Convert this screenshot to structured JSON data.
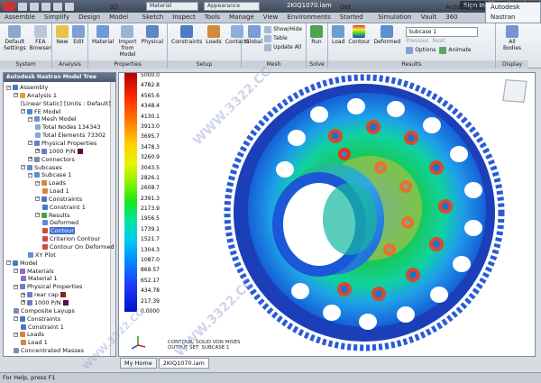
{
  "window": {
    "doc_title": "2KIQ1070.iam",
    "signin": "Sign In",
    "material_dropdown": "Material",
    "appearance_dropdown": "Appearance"
  },
  "tabs": [
    "Assemble",
    "Simplify",
    "Design",
    "3D Model",
    "Sketch",
    "Inspect",
    "Tools",
    "Manage",
    "View",
    "Environments",
    "Get Started",
    "Simulation",
    "Vault",
    "Autodesk 360",
    "Autodesk Nastran"
  ],
  "active_tab": "Autodesk Nastran",
  "ribbon": {
    "system": {
      "label": "System",
      "default_settings": "Default Settings",
      "fea_browser": "FEA Browser"
    },
    "analysis": {
      "label": "Analysis",
      "new": "New",
      "edit": "Edit"
    },
    "properties": {
      "label": "Properties",
      "material": "Material",
      "import_from_model": "Import from Model",
      "physical": "Physical"
    },
    "setup": {
      "label": "Setup",
      "constraints": "Constraints",
      "loads": "Loads",
      "contacts": "Contacts"
    },
    "mesh": {
      "label": "Mesh",
      "global": "Global",
      "show_hide": "Show/Hide",
      "table": "Table",
      "update_all": "Update All"
    },
    "solve": {
      "label": "Solve",
      "run": "Run"
    },
    "results": {
      "label": "Results",
      "load": "Load",
      "contour": "Contour",
      "deformed": "Deformed",
      "subcase_select": "Subcase 1",
      "previous": "Previous",
      "next": "Next",
      "options": "Options",
      "animate": "Animate"
    },
    "display": {
      "label": "Display",
      "all_bodies": "All Bodies"
    }
  },
  "panel": {
    "title": "Autodesk Nastran Model Tree"
  },
  "tree": [
    {
      "label": "Assembly",
      "level": 0,
      "exp": "-",
      "icon": "assembly-icon"
    },
    {
      "label": "Analysis 1",
      "level": 1,
      "exp": "-",
      "icon": "analysis-icon"
    },
    {
      "label": "[Linear Static] [Units : Default]",
      "level": 2,
      "exp": "",
      "icon": ""
    },
    {
      "label": "FE Model",
      "level": 2,
      "exp": "-",
      "icon": "fe-model-icon"
    },
    {
      "label": "Mesh Model",
      "level": 3,
      "exp": "-",
      "icon": "mesh-icon"
    },
    {
      "label": "Total Nodes 134343",
      "level": 4,
      "exp": "",
      "icon": "info-icon"
    },
    {
      "label": "Total Elements 73302",
      "level": 4,
      "exp": "",
      "icon": "info-icon"
    },
    {
      "label": "Physical Properties",
      "level": 3,
      "exp": "-",
      "icon": "property-icon"
    },
    {
      "label": "1000 P/N",
      "level": 4,
      "exp": "+",
      "icon": "property-icon",
      "swatch": "#55114a"
    },
    {
      "label": "Connectors",
      "level": 3,
      "exp": "+",
      "icon": "connector-icon"
    },
    {
      "label": "Subcases",
      "level": 2,
      "exp": "-",
      "icon": "subcase-icon"
    },
    {
      "label": "Subcase 1",
      "level": 3,
      "exp": "-",
      "icon": "subcase-icon"
    },
    {
      "label": "Loads",
      "level": 4,
      "exp": "-",
      "icon": "load-icon"
    },
    {
      "label": "Load 1",
      "level": 5,
      "exp": "",
      "icon": "load-icon"
    },
    {
      "label": "Constraints",
      "level": 4,
      "exp": "-",
      "icon": "constraint-icon"
    },
    {
      "label": "Constraint 1",
      "level": 5,
      "exp": "",
      "icon": "constraint-icon"
    },
    {
      "label": "Results",
      "level": 4,
      "exp": "-",
      "icon": "results-icon"
    },
    {
      "label": "Deformed",
      "level": 5,
      "exp": "",
      "icon": "deformed-icon"
    },
    {
      "label": "Contour",
      "level": 5,
      "exp": "",
      "icon": "contour-icon",
      "selected": true
    },
    {
      "label": "Criterion Contour",
      "level": 5,
      "exp": "",
      "icon": "contour-icon"
    },
    {
      "label": "Contour On Deformed",
      "level": 5,
      "exp": "",
      "icon": "contour-icon"
    },
    {
      "label": "XY Plot",
      "level": 3,
      "exp": "",
      "icon": "plot-icon"
    },
    {
      "label": "Model",
      "level": 0,
      "exp": "-",
      "icon": "model-icon"
    },
    {
      "label": "Materials",
      "level": 1,
      "exp": "-",
      "icon": "material-icon"
    },
    {
      "label": "Material 1",
      "level": 2,
      "exp": "",
      "icon": "material-icon"
    },
    {
      "label": "Physical Properties",
      "level": 1,
      "exp": "-",
      "icon": "property-icon"
    },
    {
      "label": "rear cap",
      "level": 2,
      "exp": "+",
      "icon": "property-icon",
      "swatch": "#8a2020"
    },
    {
      "label": "1000 P/N",
      "level": 2,
      "exp": "+",
      "icon": "property-icon",
      "swatch": "#55114a"
    },
    {
      "label": "Composite Layups",
      "level": 1,
      "exp": "",
      "icon": "layup-icon"
    },
    {
      "label": "Constraints",
      "level": 1,
      "exp": "-",
      "icon": "constraint-icon"
    },
    {
      "label": "Constraint 1",
      "level": 2,
      "exp": "",
      "icon": "constraint-icon"
    },
    {
      "label": "Loads",
      "level": 1,
      "exp": "-",
      "icon": "load-icon"
    },
    {
      "label": "Load 1",
      "level": 2,
      "exp": "",
      "icon": "load-icon"
    },
    {
      "label": "Concentrated Masses",
      "level": 1,
      "exp": "",
      "icon": "mass-icon"
    }
  ],
  "legend_values": [
    "5000.0",
    "4782.8",
    "4565.6",
    "4348.4",
    "4130.1",
    "3913.0",
    "3695.7",
    "3478.3",
    "3260.9",
    "3043.5",
    "2826.1",
    "2608.7",
    "2391.3",
    "2173.9",
    "1956.5",
    "1739.1",
    "1521.7",
    "1304.3",
    "1087.0",
    "869.57",
    "652.17",
    "434.78",
    "217.39",
    "0.0000"
  ],
  "viewport_info": {
    "line1": "CONTOUR: SOLID VON MISES",
    "line2": "OUTPUT SET: SUBCASE 1"
  },
  "doc_tabs": [
    "My Home",
    "2KIQ1070.iam"
  ],
  "status": "For Help, press F1",
  "watermark": "WWW.3322.CC"
}
